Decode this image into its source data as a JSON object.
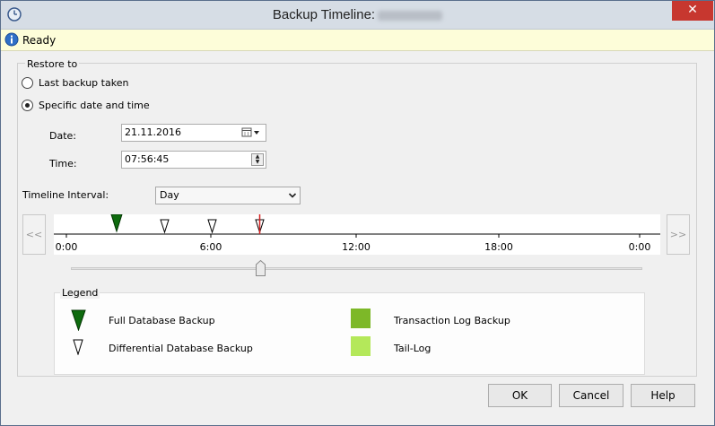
{
  "window": {
    "title": "Backup Timeline:",
    "close_label": "✕"
  },
  "status": {
    "text": "Ready"
  },
  "restore": {
    "group_label": "Restore to",
    "options": [
      {
        "label": "Last backup taken",
        "checked": false
      },
      {
        "label": "Specific date and time",
        "checked": true
      }
    ],
    "date_label": "Date:",
    "date_value": "21.11.2016",
    "time_label": "Time:",
    "time_value": "07:56:45"
  },
  "timeline": {
    "interval_label": "Timeline Interval:",
    "interval_value": "Day",
    "prev_label": "<<",
    "next_label": ">>",
    "ticks": [
      "0:00",
      "6:00",
      "12:00",
      "18:00",
      "0:00"
    ],
    "slider_fraction": 0.335
  },
  "legend": {
    "title": "Legend",
    "items": [
      {
        "label": "Full Database Backup",
        "icon": "full-backup-icon",
        "color": "#0e6b0e"
      },
      {
        "label": "Differential Database Backup",
        "icon": "differential-backup-icon",
        "color": "#ffffff"
      },
      {
        "label": "Transaction Log Backup",
        "icon": "transaction-log-icon",
        "color": "#7db828"
      },
      {
        "label": "Tail-Log",
        "icon": "tail-log-icon",
        "color": "#b4e85a"
      }
    ]
  },
  "buttons": {
    "ok": "OK",
    "cancel": "Cancel",
    "help": "Help"
  },
  "colors": {
    "restore_marker": "#d42020",
    "full_backup": "#0e6b0e"
  }
}
